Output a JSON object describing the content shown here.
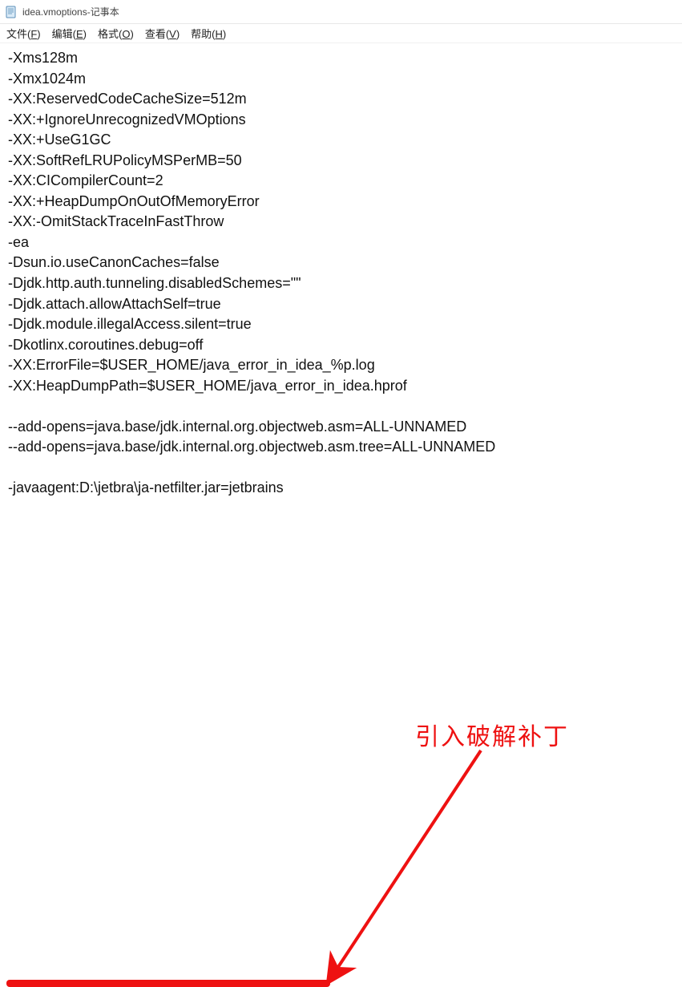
{
  "titlebar": {
    "filename": "idea.vmoptions",
    "sep": " - ",
    "appname": "记事本"
  },
  "menu": {
    "file": {
      "pre": "文件(",
      "u": "F",
      "post": ")"
    },
    "edit": {
      "pre": "编辑(",
      "u": "E",
      "post": ")"
    },
    "format": {
      "pre": "格式(",
      "u": "O",
      "post": ")"
    },
    "view": {
      "pre": "查看(",
      "u": "V",
      "post": ")"
    },
    "help": {
      "pre": "帮助(",
      "u": "H",
      "post": ")"
    }
  },
  "lines": [
    "-Xms128m",
    "-Xmx1024m",
    "-XX:ReservedCodeCacheSize=512m",
    "-XX:+IgnoreUnrecognizedVMOptions",
    "-XX:+UseG1GC",
    "-XX:SoftRefLRUPolicyMSPerMB=50",
    "-XX:CICompilerCount=2",
    "-XX:+HeapDumpOnOutOfMemoryError",
    "-XX:-OmitStackTraceInFastThrow",
    "-ea",
    "-Dsun.io.useCanonCaches=false",
    "-Djdk.http.auth.tunneling.disabledSchemes=\"\"",
    "-Djdk.attach.allowAttachSelf=true",
    "-Djdk.module.illegalAccess.silent=true",
    "-Dkotlinx.coroutines.debug=off",
    "-XX:ErrorFile=$USER_HOME/java_error_in_idea_%p.log",
    "-XX:HeapDumpPath=$USER_HOME/java_error_in_idea.hprof",
    "",
    "--add-opens=java.base/jdk.internal.org.objectweb.asm=ALL-UNNAMED",
    "--add-opens=java.base/jdk.internal.org.objectweb.asm.tree=ALL-UNNAMED",
    "",
    "-javaagent:D:\\jetbra\\ja-netfilter.jar=jetbrains"
  ],
  "annotation": {
    "text": "引入破解补丁"
  }
}
